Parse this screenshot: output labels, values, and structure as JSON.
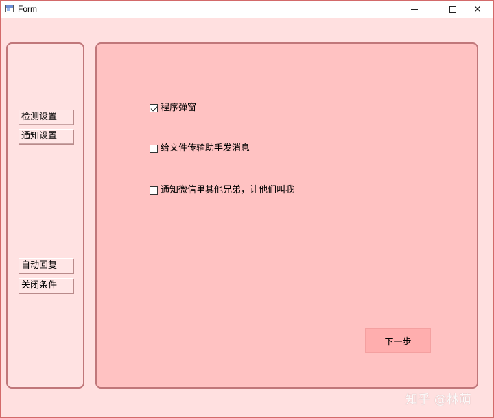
{
  "window": {
    "title": "Form",
    "controls": {
      "minimize": "—",
      "maximize": "☐",
      "close": "✕"
    }
  },
  "sidebar": {
    "items": [
      {
        "label": "检测设置"
      },
      {
        "label": "通知设置"
      },
      {
        "label": "自动回复"
      },
      {
        "label": "关闭条件"
      }
    ]
  },
  "main": {
    "options": [
      {
        "label": "程序弹窗",
        "checked": true
      },
      {
        "label": "给文件传输助手发消息",
        "checked": false
      },
      {
        "label": "通知微信里其他兄弟，让他们叫我",
        "checked": false
      }
    ],
    "next_label": "下一步"
  },
  "watermark": "知乎 @林萌",
  "colors": {
    "window_bg": "#ffe0e0",
    "panel_bg": "#ffc2c2",
    "panel_border": "#c0777a",
    "next_button_bg": "#ffaeae"
  }
}
